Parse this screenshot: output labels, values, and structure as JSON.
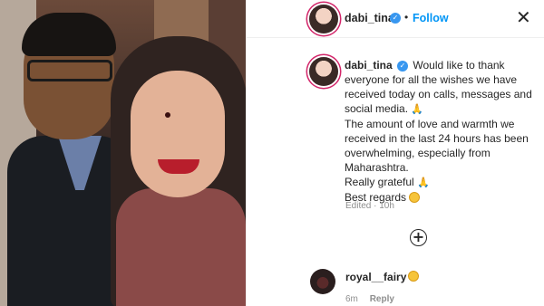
{
  "post": {
    "username": "dabi_tina",
    "verified_mark": "✓",
    "separator": "•",
    "follow_label": "Follow",
    "close_glyph": "✕"
  },
  "caption": {
    "username": "dabi_tina",
    "verified_mark": "✓",
    "line1": "Would like to thank everyone for all the wishes we have received today on calls, messages and social media.",
    "emoji1": "🙏",
    "line2": "The amount of love and warmth we received in the last 24 hours has been overwhelming, especially from Maharashtra.",
    "line3": "Really grateful",
    "emoji3": "🙏",
    "line4": "Best regards",
    "emoji4_icon": "smiling-face-icon",
    "edited_label": "Edited · 10h"
  },
  "add_button_glyph": "+",
  "comment": {
    "username": "royal__fairy",
    "emoji_icon": "smiling-face-icon",
    "time": "6m",
    "reply_label": "Reply"
  },
  "icons": {
    "close": "close-icon",
    "verified": "verified-badge-icon",
    "add": "add-comment-icon",
    "pray": "folded-hands-emoji"
  },
  "colors": {
    "follow_accent": "#0095f6",
    "verified_badge": "#3897f0",
    "story_ring": "#d3266a",
    "meta_text": "#8e8e8e"
  }
}
